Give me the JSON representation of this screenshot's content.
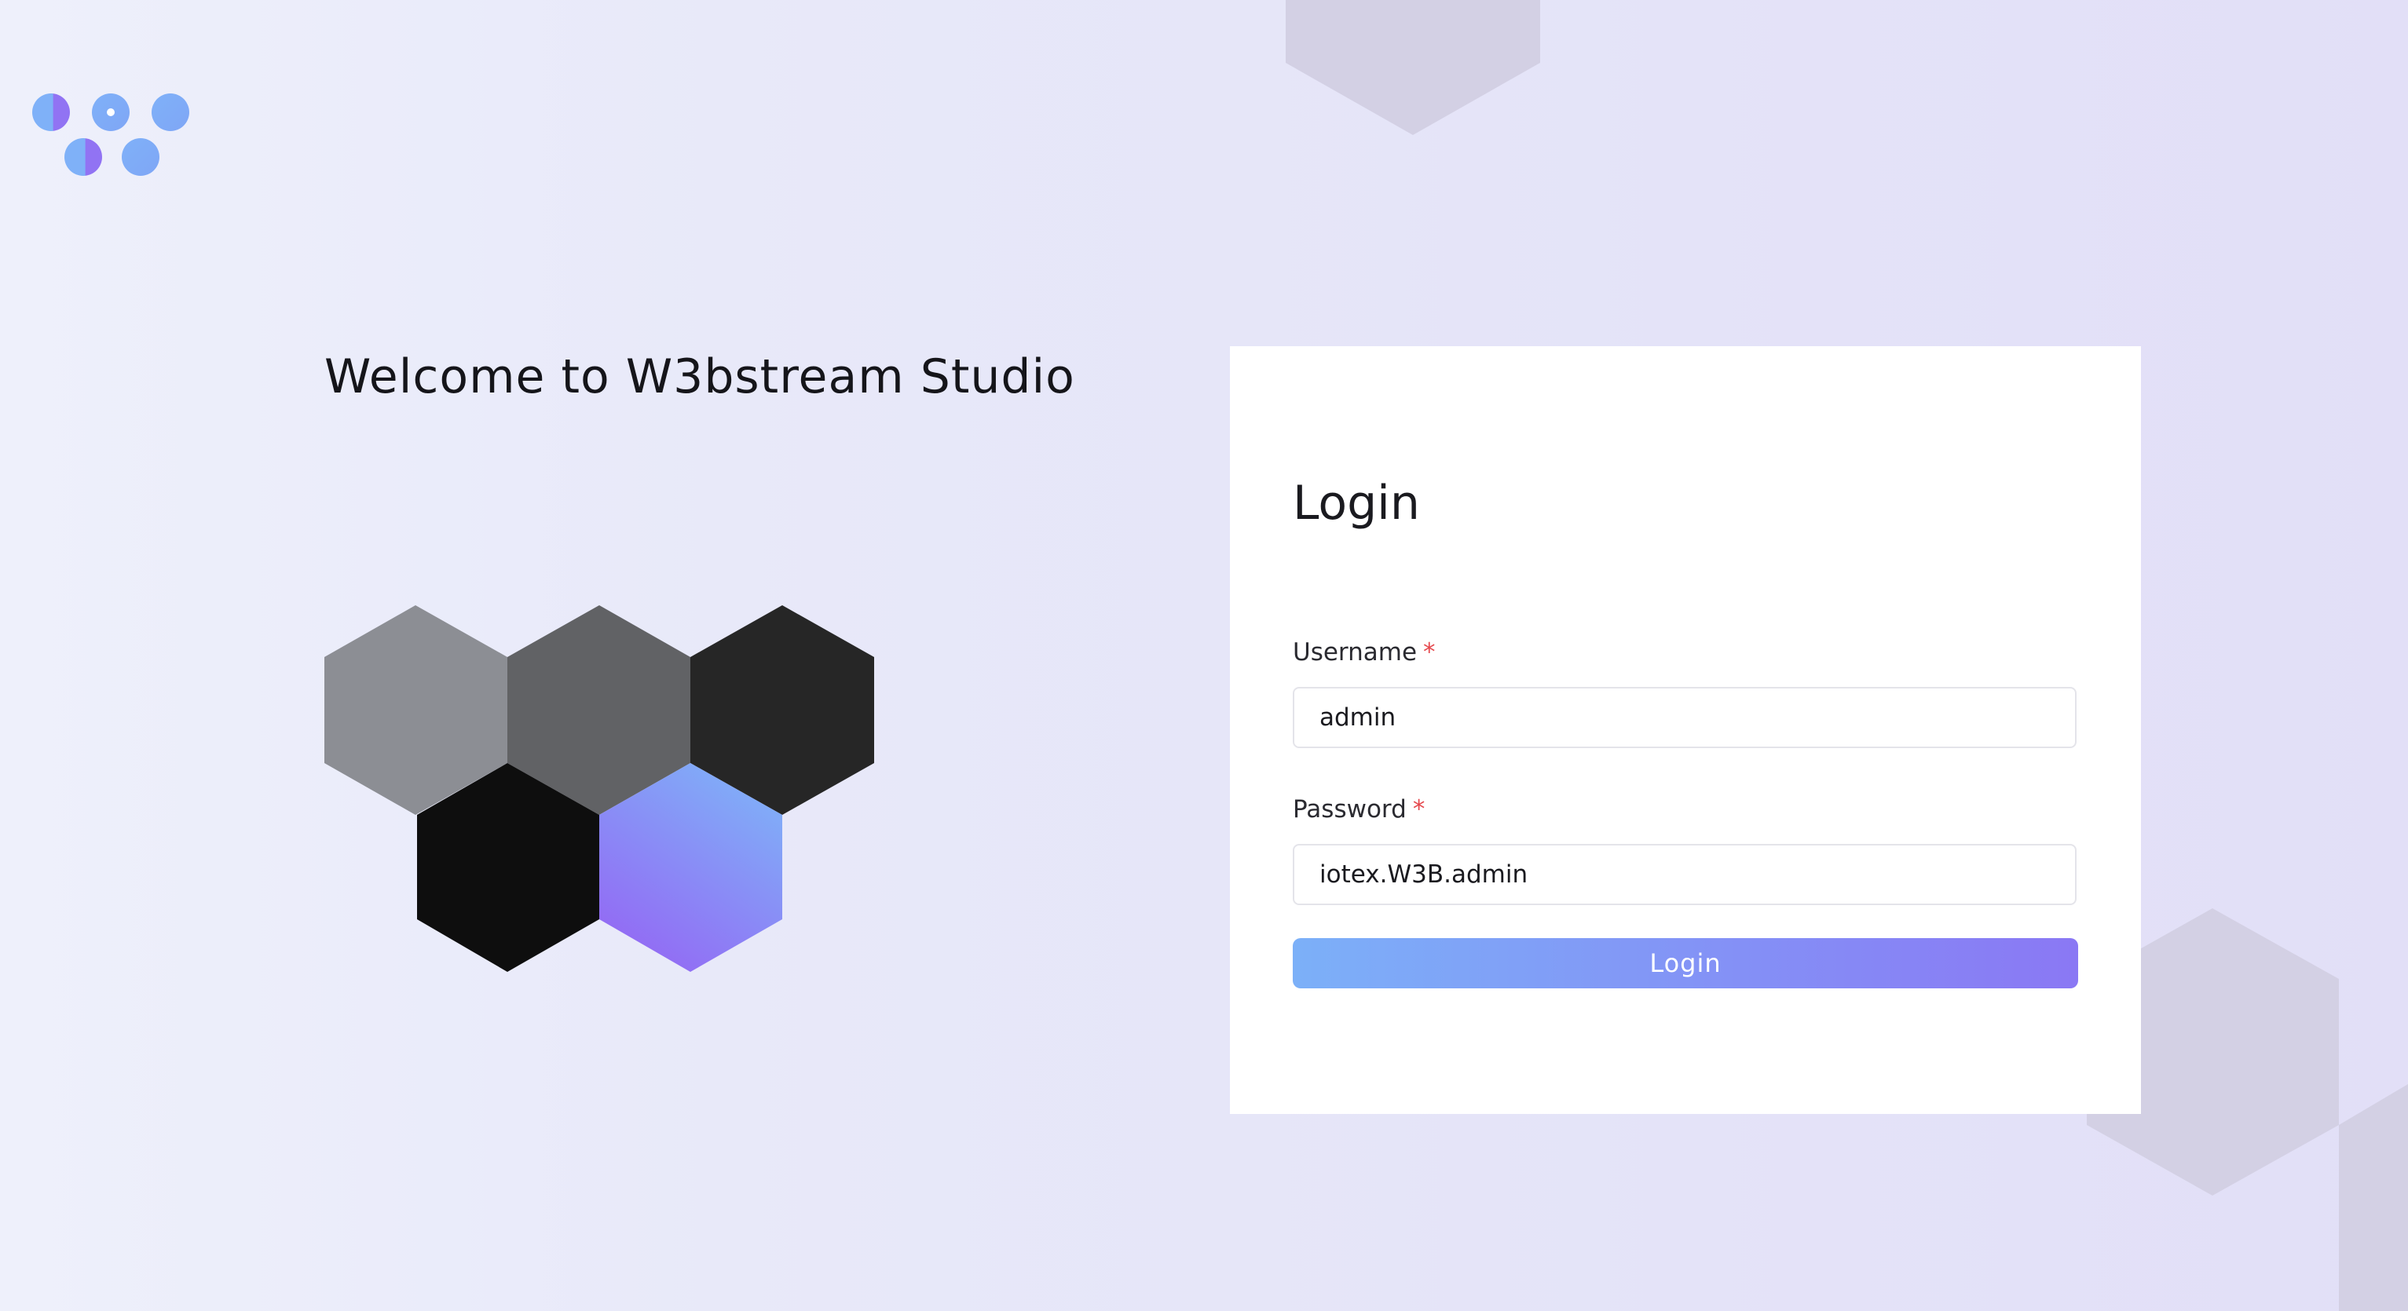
{
  "app": {
    "welcome_title": "Welcome to W3bstream Studio"
  },
  "login_form": {
    "heading": "Login",
    "username": {
      "label": "Username",
      "required_marker": "*",
      "value": "admin"
    },
    "password": {
      "label": "Password",
      "required_marker": "*",
      "value": "iotex.W3B.admin"
    },
    "submit_label": "Login"
  },
  "icons": {
    "logo": "w3bstream-dots-logo",
    "hero": "hexagon-cluster-illustration",
    "background": "decorative-hexagons"
  },
  "colors": {
    "accent_start": "#7cb0f8",
    "accent_end": "#8a78f4",
    "required": "#e5484d",
    "card": "#ffffff",
    "title_text": "#15151a"
  }
}
